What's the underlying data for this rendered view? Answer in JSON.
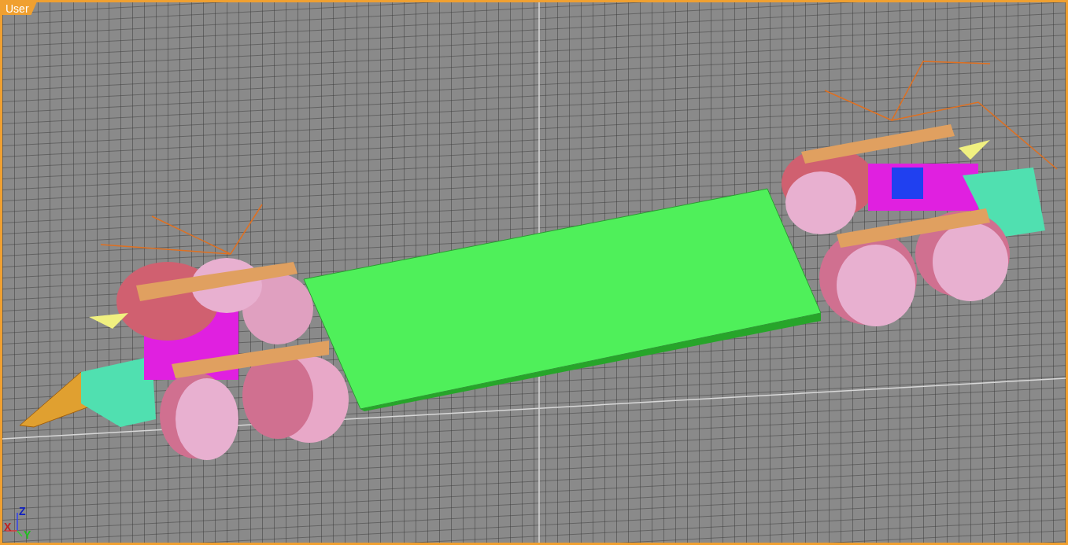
{
  "viewport": {
    "label": "User"
  },
  "axis_gizmo": {
    "x_label": "X",
    "y_label": "Y",
    "z_label": "Z"
  }
}
